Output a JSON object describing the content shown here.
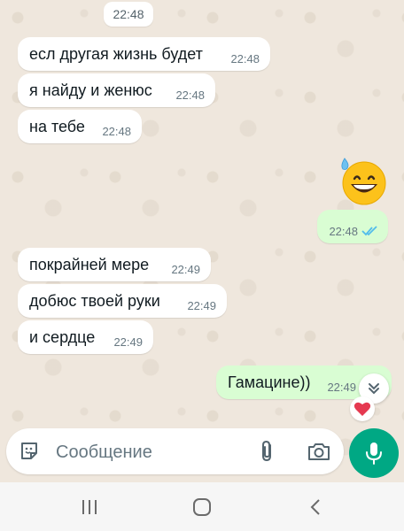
{
  "date_chip": "22:48",
  "messages": [
    {
      "text": "есл другая жизнь будет",
      "time": "22:48"
    },
    {
      "text": "я найду и женюс",
      "time": "22:48"
    },
    {
      "text": "на тебе",
      "time": "22:48"
    },
    {
      "text": "",
      "time": "22:48",
      "emoji": "grinning-face-with-sweat"
    },
    {
      "text": "покрайней мере",
      "time": "22:49"
    },
    {
      "text": "добюс твоей руки",
      "time": "22:49"
    },
    {
      "text": "и сердце",
      "time": "22:49"
    },
    {
      "text": "Гамацине))",
      "time": "22:49",
      "reaction": "heart"
    }
  ],
  "composer": {
    "placeholder": "Сообщение"
  },
  "icons": {
    "sticker": "sticker-icon",
    "attach": "paperclip-icon",
    "camera": "camera-icon",
    "mic": "microphone-icon",
    "scroll": "chevron-double-down-icon"
  },
  "colors": {
    "incoming": "#ffffff",
    "outgoing": "#d9fdd3",
    "accent": "#00a884",
    "read_ticks": "#53bdeb",
    "background": "#efe7dd"
  }
}
